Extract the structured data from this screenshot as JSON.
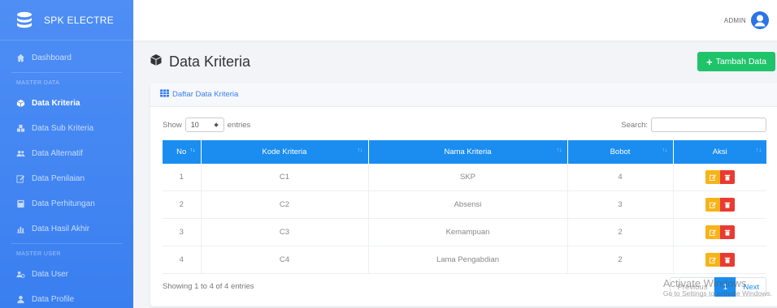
{
  "brand": {
    "name": "SPK ELECTRE",
    "icon": "database-icon"
  },
  "topbar": {
    "user_label": "ADMIN",
    "avatar_icon": "user-icon"
  },
  "sidebar": {
    "items_top": [
      {
        "label": "Dashboard",
        "icon": "home-icon"
      }
    ],
    "section_master_data": "MASTER DATA",
    "items_master": [
      {
        "label": "Data Kriteria",
        "icon": "cube-icon",
        "active": true
      },
      {
        "label": "Data Sub Kriteria",
        "icon": "cubes-icon"
      },
      {
        "label": "Data Alternatif",
        "icon": "users-icon"
      },
      {
        "label": "Data Penilaian",
        "icon": "edit-icon"
      },
      {
        "label": "Data Perhitungan",
        "icon": "calculator-icon"
      },
      {
        "label": "Data Hasil Akhir",
        "icon": "chart-icon"
      }
    ],
    "section_master_user": "MASTER USER",
    "items_user": [
      {
        "label": "Data User",
        "icon": "users-cog-icon"
      },
      {
        "label": "Data Profile",
        "icon": "user-icon"
      }
    ]
  },
  "page": {
    "title": "Data Kriteria",
    "add_button": "Tambah Data"
  },
  "card": {
    "header": "Daftar Data Kriteria",
    "show_label": "Show",
    "entries_value": "10",
    "entries_label": "entries",
    "search_label": "Search:",
    "search_value": ""
  },
  "table": {
    "columns": [
      "No",
      "Kode Kriteria",
      "Nama Kriteria",
      "Bobot",
      "Aksi"
    ],
    "rows": [
      {
        "no": "1",
        "kode": "C1",
        "nama": "SKP",
        "bobot": "4"
      },
      {
        "no": "2",
        "kode": "C2",
        "nama": "Absensi",
        "bobot": "3"
      },
      {
        "no": "3",
        "kode": "C3",
        "nama": "Kemampuan",
        "bobot": "2"
      },
      {
        "no": "4",
        "kode": "C4",
        "nama": "Lama Pengabdian",
        "bobot": "2"
      }
    ]
  },
  "footer": {
    "info": "Showing 1 to 4 of 4 entries",
    "previous": "Previous",
    "current_page": "1",
    "next": "Next"
  },
  "watermark": {
    "title": "Activate Windows",
    "subtitle": "Go to Settings to activate Windows."
  },
  "colors": {
    "sidebar": "#3a7ff0",
    "table_header": "#1b8df0",
    "add_button": "#1fc36a",
    "edit_button": "#f6b31b",
    "delete_button": "#e93b32"
  }
}
